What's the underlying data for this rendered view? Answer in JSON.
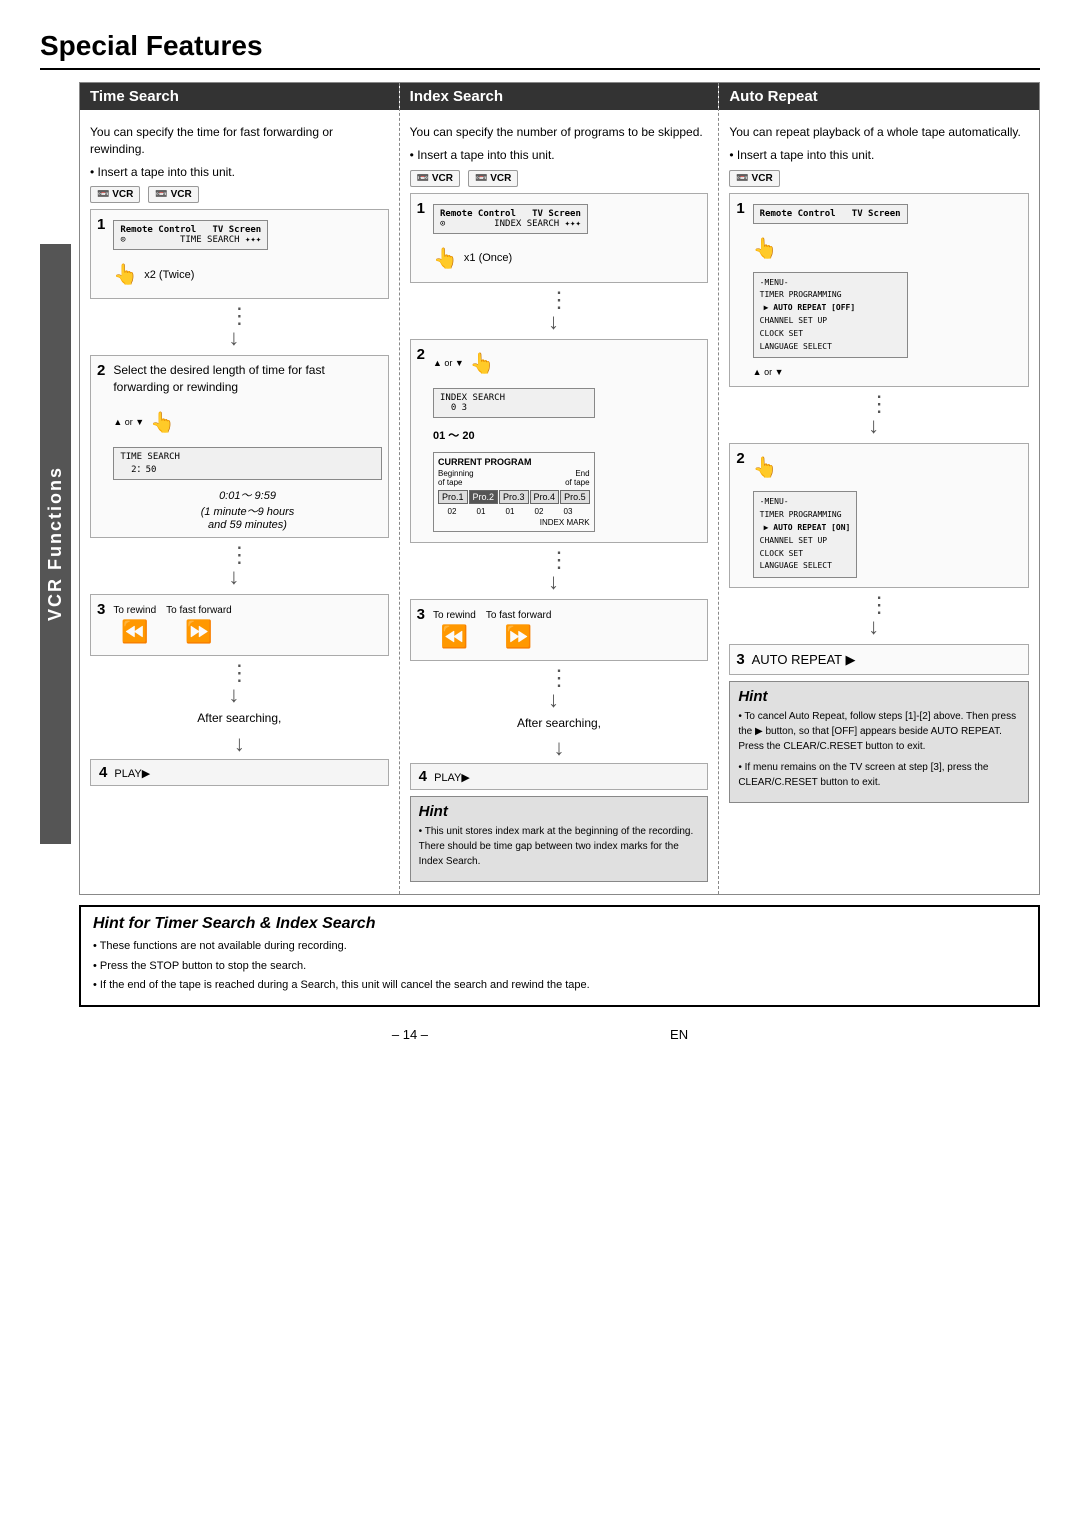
{
  "page": {
    "title": "Special Features",
    "footer": "– 14 –",
    "footer_right": "EN"
  },
  "sidebar": {
    "label": "VCR Functions"
  },
  "columns": {
    "time_search": {
      "header": "Time Search",
      "desc1": "You can specify the time for fast forwarding or rewinding.",
      "bullet1": "Insert a tape into this unit.",
      "step1_label": "1",
      "step1_note": "x2 (Twice)",
      "step1_screen_title": "Remote Control  TV Screen",
      "step1_screen_text": "TIME SEARCH",
      "step2_label": "2",
      "step2_desc": "Select the desired length of time for fast forwarding or rewinding",
      "step2_screen_text": "TIME SEARCH\n  2：50",
      "step2_time": "0:01～ 9:59\n(1 minute～9 hours\nand 59 minutes)",
      "step3_label": "3",
      "step3_rewind": "To rewind",
      "step3_forward": "To fast forward",
      "after_searching": "After searching,",
      "step4_label": "4",
      "step4_text": "PLAY▶"
    },
    "index_search": {
      "header": "Index Search",
      "desc1": "You can specify the number of programs to be skipped.",
      "bullet1": "Insert a tape into this unit.",
      "step1_label": "1",
      "step1_note": "x1 (Once)",
      "step1_screen_title": "Remote Control  TV Screen",
      "step1_screen_text": "INDEX SEARCH",
      "step2_label": "2",
      "step2_screen_text": "INDEX SEARCH\n  0 3",
      "step2_range": "01 ～ 20",
      "step2_diagram_title": "CURRENT PROGRAM",
      "step2_begin": "Beginning\nof tape",
      "step2_end": "End\nof tape",
      "step2_progs": [
        "Pro.1",
        "Pro.2",
        "Pro.3",
        "Pro.4",
        "Pro.5"
      ],
      "step2_nums": [
        "02",
        "01",
        "01",
        "02",
        "03"
      ],
      "step2_index_label": "INDEX MARK",
      "step3_label": "3",
      "step3_rewind": "To rewind",
      "step3_forward": "To fast forward",
      "after_searching": "After searching,",
      "step4_label": "4",
      "step4_text": "PLAY▶",
      "hint_title": "Hint",
      "hint_text": "• This unit stores index mark at the beginning of the recording. There should be time gap between two index marks for the Index Search."
    },
    "auto_repeat": {
      "header": "Auto Repeat",
      "desc1": "You can repeat playback of a whole tape automatically.",
      "bullet1": "Insert a tape into this unit.",
      "step1_label": "1",
      "step1_screen_title": "Remote Control  TV Screen",
      "step1_menu": [
        "-MENU-",
        "TIMER PROGRAMMING",
        "▶ AUTO REPEAT [OFF]",
        "CHANNEL SET UP",
        "CLOCK SET",
        "LANGUAGE SELECT"
      ],
      "step2_label": "2",
      "step2_menu": [
        "-MENU-",
        "TIMER PROGRAMMING",
        "▶ AUTO REPEAT [ON]",
        "CHANNEL SET UP",
        "CLOCK SET",
        "LANGUAGE SELECT"
      ],
      "step3_label": "3",
      "step3_text": "AUTO REPEAT ▶",
      "hint_title": "Hint",
      "hint_lines": [
        "• To cancel Auto Repeat, follow steps [1]-[2] above. Then press the ▶ button, so that [OFF] appears beside AUTO REPEAT. Press the CLEAR/C.RESET button to exit.",
        "• If menu remains on the TV screen at step [3], press the CLEAR/C.RESET button to exit."
      ]
    }
  },
  "bottom_hint": {
    "title": "Hint for Timer Search & Index Search",
    "lines": [
      "• These functions are not available during recording.",
      "• Press the STOP button to stop the search.",
      "• If the end of the tape is reached during a Search, this unit will cancel the search and rewind the tape."
    ]
  }
}
